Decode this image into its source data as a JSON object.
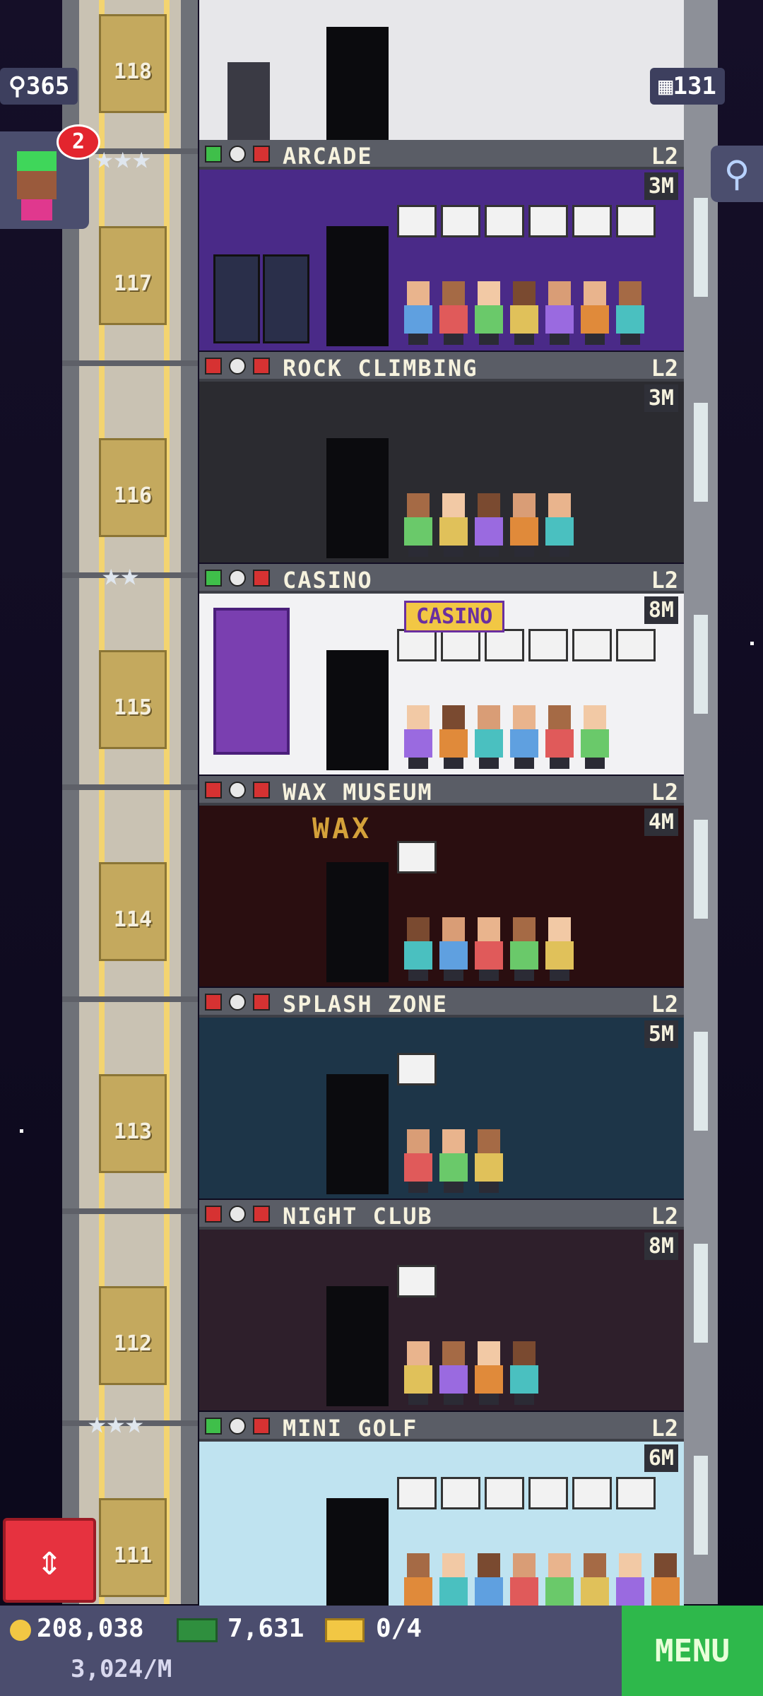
{
  "hud": {
    "population": "365",
    "floors_count": "131",
    "notification_count": "2"
  },
  "shaft_floors": [
    "118",
    "117",
    "116",
    "115",
    "114",
    "113",
    "112",
    "111"
  ],
  "floors": [
    {
      "name": "ARCADE",
      "level": "L2",
      "stock": "3M",
      "checked": true,
      "room_color": "#4a2a88"
    },
    {
      "name": "ROCK CLIMBING",
      "level": "L2",
      "stock": "3M",
      "checked": false,
      "room_color": "#2b2b30"
    },
    {
      "name": "CASINO",
      "level": "L2",
      "stock": "8M",
      "checked": true,
      "room_color": "#f2f2f4"
    },
    {
      "name": "WAX MUSEUM",
      "level": "L2",
      "stock": "4M",
      "checked": false,
      "room_color": "#2a0e10"
    },
    {
      "name": "SPLASH ZONE",
      "level": "L2",
      "stock": "5M",
      "checked": false,
      "room_color": "#1d3548"
    },
    {
      "name": "NIGHT CLUB",
      "level": "L2",
      "stock": "8M",
      "checked": false,
      "room_color": "#2e1f2b"
    },
    {
      "name": "MINI GOLF",
      "level": "L2",
      "stock": "6M",
      "checked": true,
      "room_color": "#bfe3f0"
    }
  ],
  "casino_sign": "CASINO",
  "wax_sign": "WAX",
  "bottom": {
    "coins": "208,038",
    "bux": "7,631",
    "tickets": "0/4",
    "rate": "3,024/M",
    "menu": "MENU"
  },
  "colors": {
    "accent": "#2eb84b",
    "elevator_button": "#e6323f",
    "hud_panel": "#3d3f5e"
  }
}
